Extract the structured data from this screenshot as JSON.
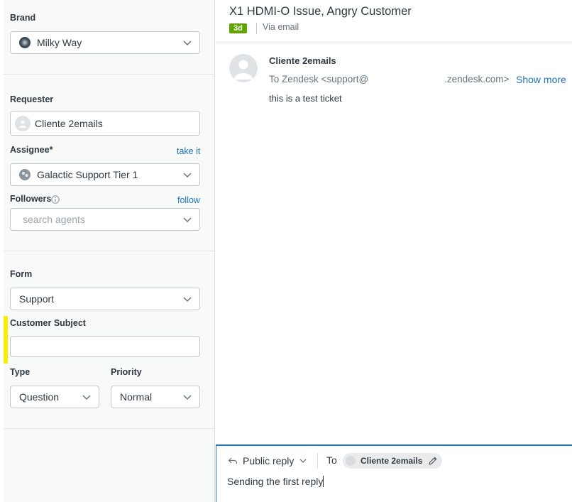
{
  "sidebar": {
    "brand": {
      "label": "Brand",
      "value": "Milky Way"
    },
    "requester": {
      "label": "Requester",
      "value": "Cliente 2emails"
    },
    "assignee": {
      "label": "Assignee*",
      "action": "take it",
      "value": "Galactic Support Tier 1"
    },
    "followers": {
      "label": "Followers",
      "action": "follow",
      "placeholder": "search agents"
    },
    "form": {
      "label": "Form",
      "value": "Support"
    },
    "customer_subject": {
      "label": "Customer Subject",
      "value": ""
    },
    "type": {
      "label": "Type",
      "value": "Question"
    },
    "priority": {
      "label": "Priority",
      "value": "Normal"
    }
  },
  "ticket": {
    "subject": "X1 HDMI-O Issue, Angry Customer",
    "age_badge": "3d",
    "channel": "Via email",
    "message": {
      "sender": "Cliente 2emails",
      "to_prefix": "To Zendesk <support@",
      "to_suffix": ".zendesk.com>",
      "show_more": "Show more",
      "body": "this is a test ticket"
    }
  },
  "composer": {
    "reply_type": "Public reply",
    "to_label": "To",
    "recipient": "Cliente 2emails",
    "text": "Sending the first reply"
  },
  "colors": {
    "accent": "#1f73b7",
    "badge_green": "#5ea500",
    "highlight_yellow": "#f7ef02"
  },
  "icons": [
    "chevron-down-icon",
    "info-icon",
    "user-icon",
    "reply-icon",
    "pencil-icon",
    "brand-logo-icon",
    "group-icon"
  ]
}
